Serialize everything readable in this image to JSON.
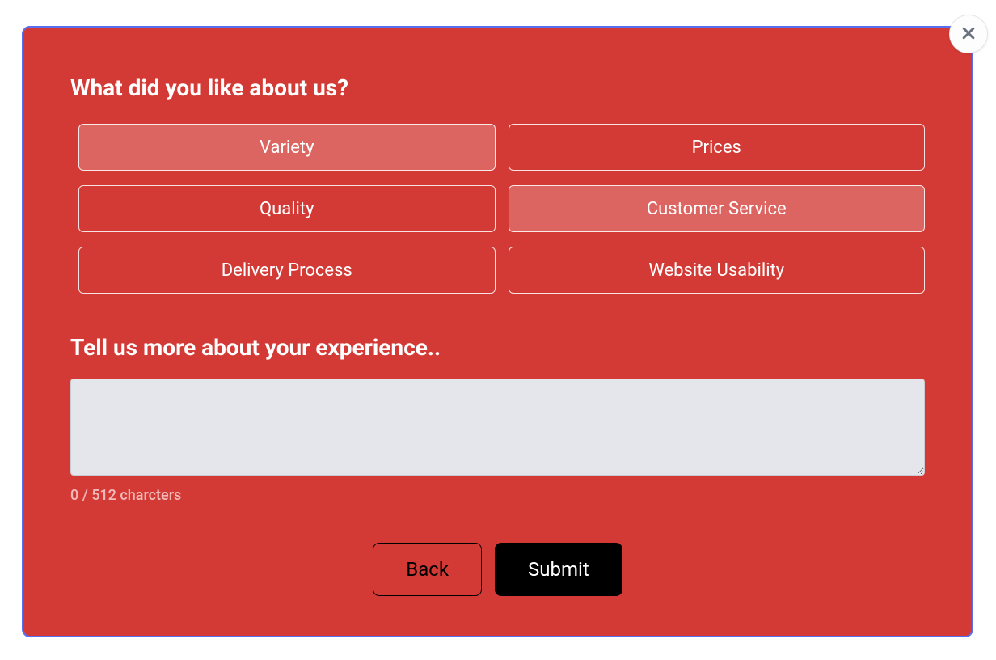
{
  "heading1": "What did you like about us?",
  "options": [
    {
      "label": "Variety",
      "selected": true
    },
    {
      "label": "Prices",
      "selected": false
    },
    {
      "label": "Quality",
      "selected": false
    },
    {
      "label": "Customer Service",
      "selected": true
    },
    {
      "label": "Delivery Process",
      "selected": false
    },
    {
      "label": "Website Usability",
      "selected": false
    }
  ],
  "heading2": "Tell us more about your experience..",
  "textarea_value": "",
  "char_counter": "0 / 512 charcters",
  "back_label": "Back",
  "submit_label": "Submit"
}
